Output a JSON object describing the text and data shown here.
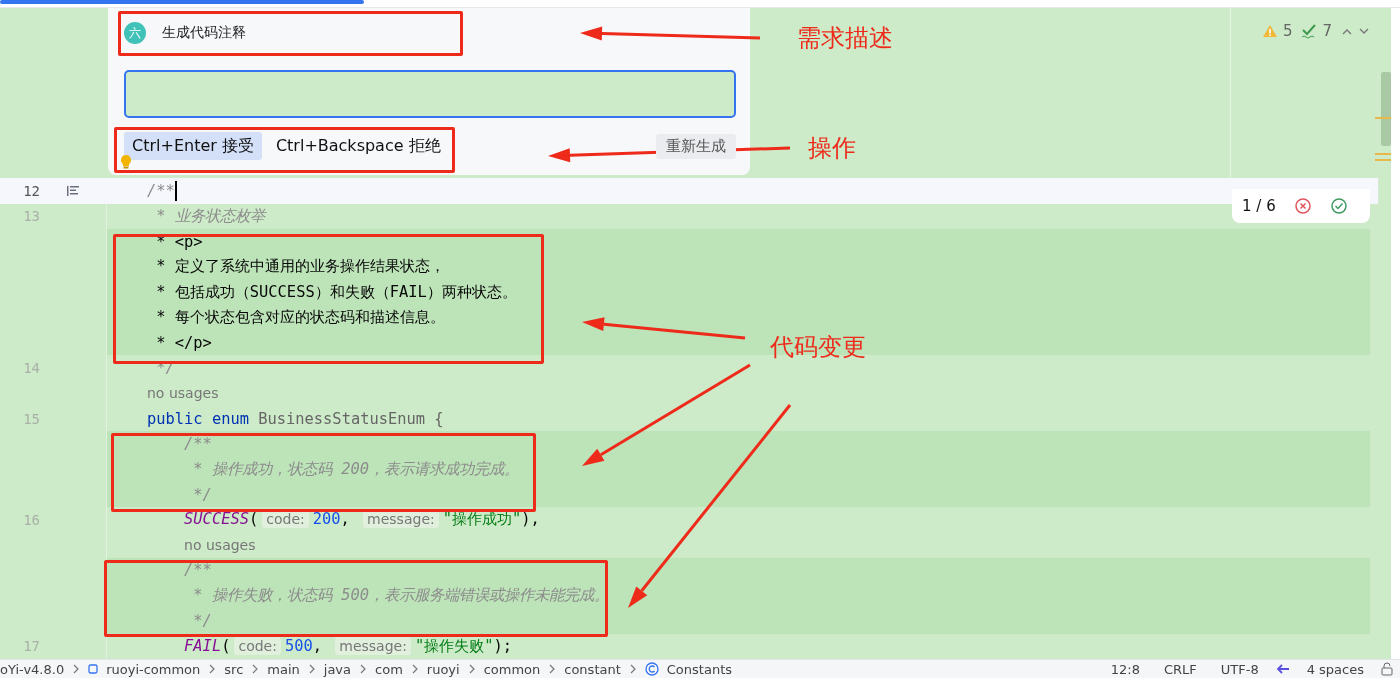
{
  "loading_bar": {
    "level": 0.26
  },
  "prompt_panel": {
    "badge": "六",
    "title": "生成代码注释",
    "actions": [
      {
        "label": "Ctrl+Enter 接受",
        "selected": true
      },
      {
        "label": "Ctrl+Backspace 拒绝",
        "selected": false
      }
    ],
    "regenerate": "重新生成"
  },
  "inspections": {
    "warnings": "5",
    "checks": "7"
  },
  "diff_nav": {
    "counter": "1 / 6"
  },
  "code_lines": [
    {
      "number": "12",
      "kind": "current",
      "tokens": [
        {
          "text": "/**",
          "kind": "doc"
        }
      ]
    },
    {
      "number": "13",
      "kind": "code",
      "tokens": [
        {
          "text": " * 业务状态枚举",
          "kind": "doc"
        }
      ]
    },
    {
      "kind": "added",
      "tokens": [
        {
          "text": " * <p>",
          "kind": "text"
        }
      ]
    },
    {
      "kind": "added",
      "tokens": [
        {
          "text": " * 定义了系统中通用的业务操作结果状态，",
          "kind": "text"
        }
      ]
    },
    {
      "kind": "added",
      "tokens": [
        {
          "text": " * 包括成功（SUCCESS）和失败（FAIL）两种状态。",
          "kind": "text"
        }
      ]
    },
    {
      "kind": "added",
      "tokens": [
        {
          "text": " * 每个状态包含对应的状态码和描述信息。",
          "kind": "text"
        }
      ]
    },
    {
      "kind": "added",
      "tokens": [
        {
          "text": " * </p>",
          "kind": "text"
        }
      ]
    },
    {
      "number": "14",
      "kind": "code",
      "tokens": [
        {
          "text": " */",
          "kind": "doc"
        }
      ]
    },
    {
      "kind": "code",
      "tokens": [
        {
          "text": "no usages",
          "kind": "usage"
        }
      ]
    },
    {
      "number": "15",
      "kind": "code",
      "tokens": [
        {
          "text": "public ",
          "kind": "kw"
        },
        {
          "text": "enum",
          "kind": "kw"
        },
        {
          "text": " BusinessStatusEnum {",
          "kind": "name"
        }
      ]
    },
    {
      "kind": "added",
      "tokens": [
        {
          "text": "    /**",
          "kind": "doc"
        }
      ]
    },
    {
      "kind": "added",
      "tokens": [
        {
          "text": "     * 操作成功，状态码 200，表示请求成功完成。",
          "kind": "doc"
        }
      ]
    },
    {
      "kind": "added",
      "tokens": [
        {
          "text": "     */",
          "kind": "doc"
        }
      ]
    },
    {
      "number": "16",
      "kind": "code",
      "tokens": [
        {
          "text": "    SUCCESS",
          "kind": "const"
        },
        {
          "text": "(",
          "kind": "text"
        },
        {
          "text": "code:",
          "kind": "hint"
        },
        {
          "text": "200",
          "kind": "num"
        },
        {
          "text": ", ",
          "kind": "text"
        },
        {
          "text": "message:",
          "kind": "hint"
        },
        {
          "text": "\"操作成功\"",
          "kind": "str"
        },
        {
          "text": "),",
          "kind": "text"
        }
      ]
    },
    {
      "kind": "code",
      "tokens": [
        {
          "text": "    no usages",
          "kind": "usage"
        }
      ]
    },
    {
      "kind": "added",
      "tokens": [
        {
          "text": "    /**",
          "kind": "doc"
        }
      ]
    },
    {
      "kind": "added",
      "tokens": [
        {
          "text": "     * 操作失败，状态码 500，表示服务端错误或操作未能完成。",
          "kind": "doc"
        }
      ]
    },
    {
      "kind": "added",
      "tokens": [
        {
          "text": "     */",
          "kind": "doc"
        }
      ]
    },
    {
      "number": "17",
      "kind": "code",
      "tokens": [
        {
          "text": "    FAIL",
          "kind": "const"
        },
        {
          "text": "(",
          "kind": "text"
        },
        {
          "text": "code:",
          "kind": "hint"
        },
        {
          "text": "500",
          "kind": "num"
        },
        {
          "text": ", ",
          "kind": "text"
        },
        {
          "text": "message:",
          "kind": "hint"
        },
        {
          "text": "\"操作失败\"",
          "kind": "str"
        },
        {
          "text": ");",
          "kind": "text"
        }
      ]
    }
  ],
  "status_bar": {
    "breadcrumbs": [
      "oYi-v4.8.0",
      "ruoyi-common",
      "src",
      "main",
      "java",
      "com",
      "ruoyi",
      "common",
      "constant",
      "Constants"
    ],
    "items": [
      "12:8",
      "CRLF",
      "UTF-8",
      "4 spaces"
    ]
  },
  "annotations": [
    {
      "label": "需求描述"
    },
    {
      "label": "操作"
    },
    {
      "label": "代码变更"
    }
  ]
}
